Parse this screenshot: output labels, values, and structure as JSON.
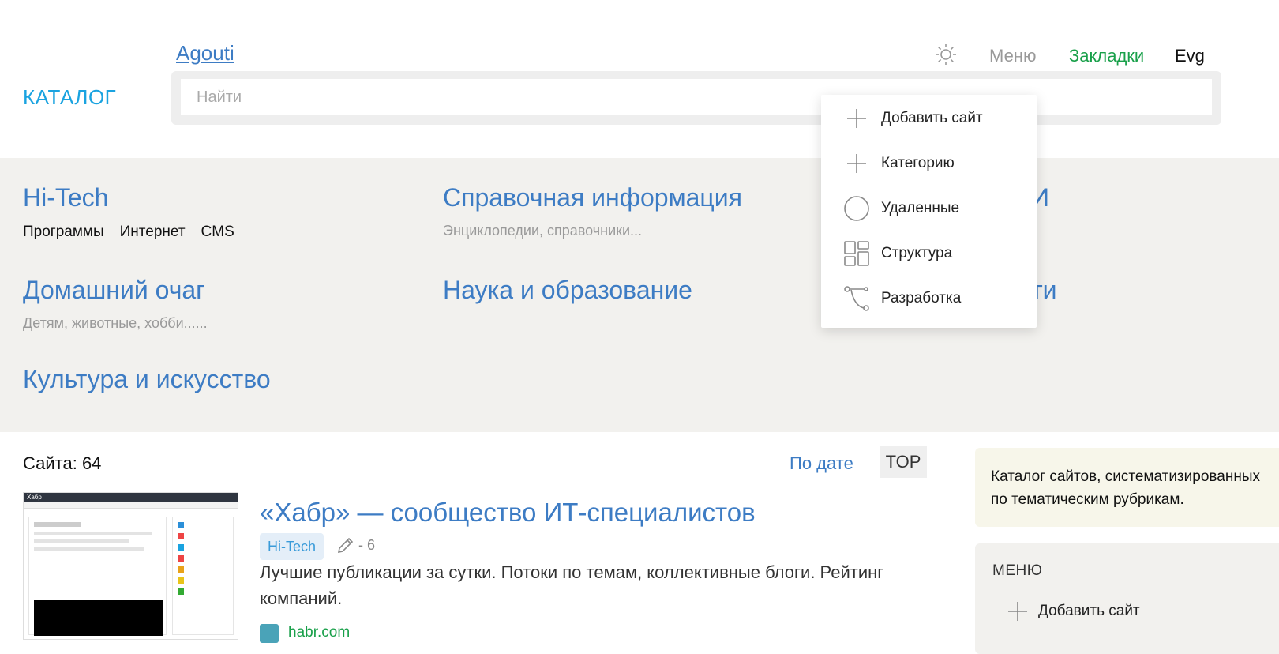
{
  "header": {
    "breadcrumb": "Agouti",
    "logo": "КАТАЛОГ",
    "search_placeholder": "Найти",
    "nav": {
      "menu": "Меню",
      "bookmarks": "Закладки",
      "user": "Evg"
    }
  },
  "categories": [
    {
      "title": "Hi-Tech",
      "links": [
        "Программы",
        "Интернет",
        "CMS"
      ]
    },
    {
      "title": "Справочная информация",
      "subtitle": "Энциклопедии, справочники..."
    },
    {
      "title_partial": "И"
    },
    {
      "title": "Домашний очаг",
      "subtitle": "Детям, животные, хобби......"
    },
    {
      "title": "Наука и образование"
    },
    {
      "title_partial": "ти"
    },
    {
      "title": "Культура и искусство"
    }
  ],
  "dropdown": {
    "items": [
      {
        "label": "Добавить сайт",
        "icon": "plus-icon"
      },
      {
        "label": "Категорию",
        "icon": "plus-icon"
      },
      {
        "label": "Удаленные",
        "icon": "circle-icon"
      },
      {
        "label": "Структура",
        "icon": "layout-icon"
      },
      {
        "label": "Разработка",
        "icon": "bezier-icon"
      }
    ]
  },
  "main": {
    "count_label": "Сайта: 64",
    "sort_date": "По дате",
    "sort_top": "TOP",
    "item": {
      "title": "«Хабр» — сообщество ИТ-специалистов",
      "tag": "Hi-Tech",
      "edit_count": "- 6",
      "description": "Лучшие публикации за сутки. Потоки по темам, коллективные блоги. Рейтинг компаний.",
      "url": "habr.com",
      "thumb_title": "Хабр"
    }
  },
  "sidebar": {
    "info": "Каталог сайтов, систематизированных по тематическим рубрикам.",
    "menu_heading": "МЕНЮ",
    "menu_add": "Добавить сайт"
  },
  "colors": {
    "link": "#3d7cc4",
    "logo": "#1aa3e0",
    "bookmarks": "#19a04a",
    "band": "#f2f1ee"
  }
}
